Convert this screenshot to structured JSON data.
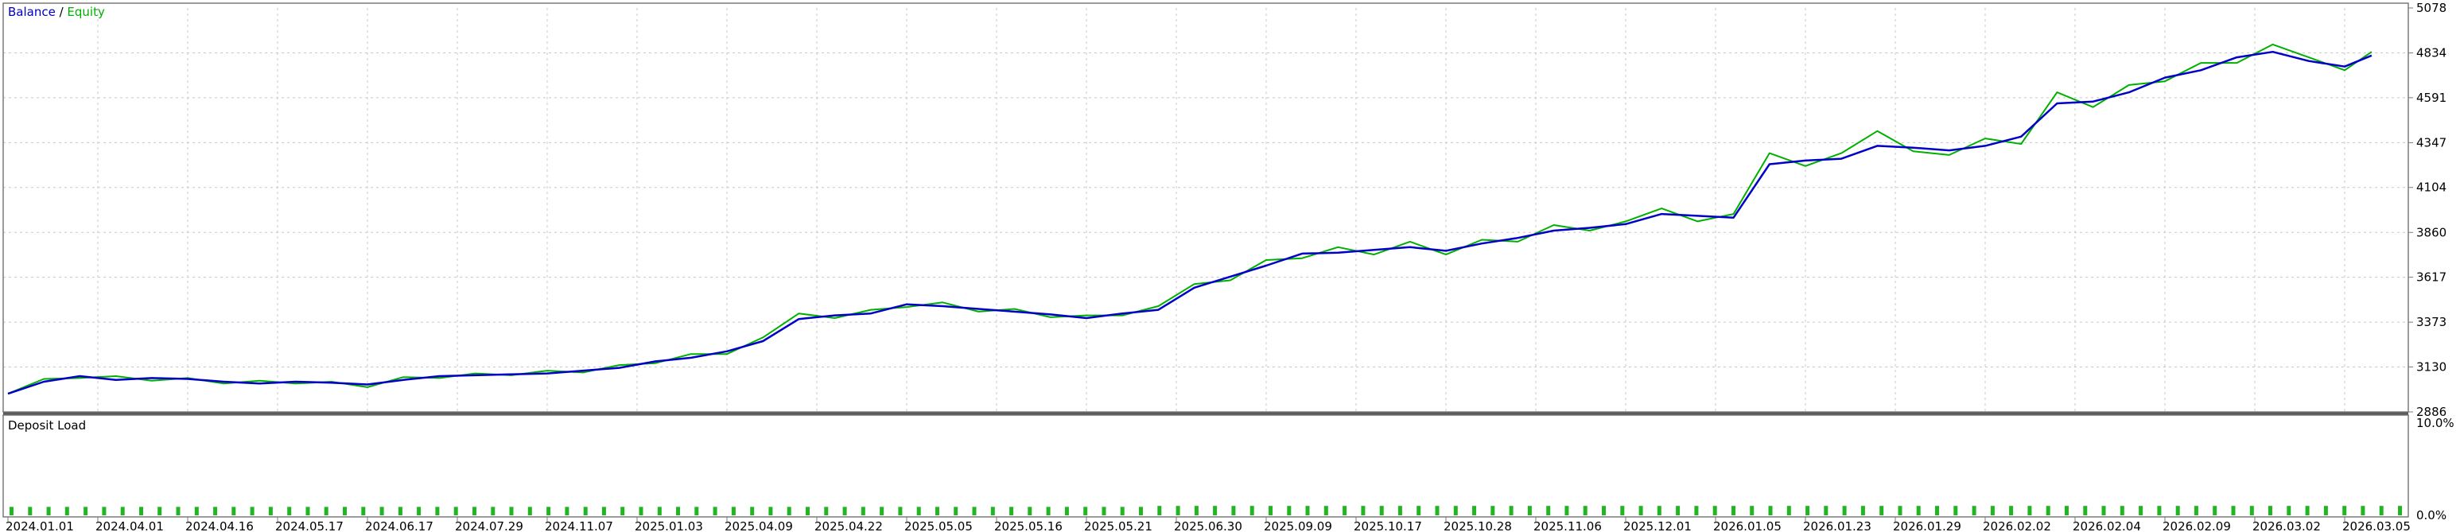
{
  "chart_data": [
    {
      "type": "line",
      "title": "Balance / Equity",
      "legend": [
        {
          "name": "Balance",
          "color": "#0000c8"
        },
        {
          "name": "Equity",
          "color": "#00b000"
        }
      ],
      "title_separator": " / ",
      "ylim": [
        2886,
        5078
      ],
      "y_ticks": [
        "5078",
        "4834",
        "4591",
        "4347",
        "4104",
        "3860",
        "3617",
        "3373",
        "3130",
        "2886"
      ],
      "x_ticks": [
        "2024.01.01",
        "2024.04.01",
        "2024.04.16",
        "2024.05.17",
        "2024.06.17",
        "2024.07.29",
        "2024.11.07",
        "2025.01.03",
        "2025.04.09",
        "2025.04.22",
        "2025.05.05",
        "2025.05.16",
        "2025.05.21",
        "2025.06.30",
        "2025.09.09",
        "2025.10.17",
        "2025.10.28",
        "2025.11.06",
        "2025.12.01",
        "2026.01.05",
        "2026.01.23",
        "2026.01.29",
        "2026.02.02",
        "2026.02.04",
        "2026.02.09",
        "2026.03.02",
        "2026.03.05"
      ],
      "grid": true,
      "legend_placement": "top-left",
      "series": [
        {
          "name": "Balance",
          "color": "#0000c8",
          "x_tick_index": [
            0,
            0.4,
            0.8,
            1.2,
            1.6,
            2.0,
            2.4,
            2.8,
            3.2,
            3.6,
            4.0,
            4.4,
            4.8,
            5.2,
            5.6,
            6.0,
            6.4,
            6.8,
            7.2,
            7.6,
            8.0,
            8.4,
            8.8,
            9.2,
            9.6,
            10.0,
            10.4,
            10.8,
            11.2,
            11.6,
            12.0,
            12.4,
            12.8,
            13.2,
            13.6,
            14.0,
            14.4,
            14.8,
            15.2,
            15.6,
            16.0,
            16.4,
            16.8,
            17.2,
            17.6,
            18.0,
            18.4,
            18.8,
            19.2,
            19.6,
            20.0,
            20.4,
            20.8,
            21.2,
            21.6,
            22.0,
            22.4,
            22.8,
            23.2,
            23.6,
            24.0,
            24.4,
            24.8,
            25.2,
            25.6,
            26.0,
            26.3
          ],
          "values": [
            2985,
            3050,
            3080,
            3060,
            3070,
            3065,
            3050,
            3040,
            3050,
            3045,
            3035,
            3060,
            3080,
            3085,
            3090,
            3095,
            3110,
            3125,
            3160,
            3180,
            3215,
            3270,
            3390,
            3410,
            3420,
            3470,
            3460,
            3445,
            3430,
            3415,
            3395,
            3420,
            3440,
            3560,
            3620,
            3680,
            3745,
            3750,
            3765,
            3780,
            3760,
            3800,
            3830,
            3870,
            3885,
            3905,
            3960,
            3950,
            3940,
            4230,
            4250,
            4260,
            4330,
            4320,
            4305,
            4330,
            4380,
            4560,
            4570,
            4620,
            4700,
            4740,
            4810,
            4840,
            4790,
            4760,
            4820
          ]
        },
        {
          "name": "Equity",
          "color": "#00b000",
          "x_tick_index": [
            0,
            0.4,
            0.8,
            1.2,
            1.6,
            2.0,
            2.4,
            2.8,
            3.2,
            3.6,
            4.0,
            4.4,
            4.8,
            5.2,
            5.6,
            6.0,
            6.4,
            6.8,
            7.2,
            7.6,
            8.0,
            8.4,
            8.8,
            9.2,
            9.6,
            10.0,
            10.4,
            10.8,
            11.2,
            11.6,
            12.0,
            12.4,
            12.8,
            13.2,
            13.6,
            14.0,
            14.4,
            14.8,
            15.2,
            15.6,
            16.0,
            16.4,
            16.8,
            17.2,
            17.6,
            18.0,
            18.4,
            18.8,
            19.2,
            19.6,
            20.0,
            20.4,
            20.8,
            21.2,
            21.6,
            22.0,
            22.4,
            22.8,
            23.2,
            23.6,
            24.0,
            24.4,
            24.8,
            25.2,
            25.6,
            26.0,
            26.3
          ],
          "values": [
            2985,
            3065,
            3070,
            3080,
            3055,
            3070,
            3040,
            3055,
            3040,
            3050,
            3020,
            3075,
            3070,
            3095,
            3085,
            3110,
            3100,
            3140,
            3150,
            3200,
            3200,
            3290,
            3420,
            3395,
            3440,
            3455,
            3480,
            3430,
            3445,
            3400,
            3410,
            3410,
            3460,
            3580,
            3600,
            3710,
            3720,
            3780,
            3740,
            3810,
            3740,
            3820,
            3810,
            3900,
            3870,
            3920,
            3990,
            3920,
            3960,
            4290,
            4220,
            4290,
            4410,
            4300,
            4280,
            4370,
            4340,
            4620,
            4540,
            4660,
            4680,
            4780,
            4780,
            4880,
            4810,
            4740,
            4840
          ]
        }
      ]
    },
    {
      "type": "bar",
      "title": "Deposit Load",
      "ylim": [
        0,
        10
      ],
      "y_ticks": [
        "10.0%",
        "0.0%"
      ],
      "color": "#22b422",
      "values": [
        0.9,
        0.9,
        0.9,
        0.9,
        0.9,
        0.9,
        0.9,
        0.9,
        0.9,
        0.9,
        0.9,
        0.9,
        0.9,
        0.9,
        0.9,
        0.9,
        0.9,
        0.9,
        0.9,
        0.9,
        0.9,
        0.9,
        0.9,
        0.9,
        0.9,
        0.9,
        0.9,
        0.9,
        0.9,
        0.9,
        0.9,
        0.9,
        0.9,
        0.9,
        0.9,
        0.9,
        0.9,
        0.9,
        0.9,
        0.9,
        0.9,
        0.9,
        0.9,
        0.9,
        0.9,
        0.9,
        0.9,
        0.9,
        0.9,
        0.9,
        0.9,
        0.9,
        0.9,
        0.9,
        0.9,
        0.9,
        0.9,
        0.9,
        0.9,
        0.9,
        0.9,
        0.9,
        1.0,
        1.0,
        1.0,
        1.0,
        1.0,
        1.0,
        1.0,
        1.0,
        1.0,
        1.0,
        1.0,
        1.0,
        1.0,
        1.0,
        1.0,
        1.0,
        1.0,
        1.0,
        1.0,
        1.0,
        1.0,
        1.0,
        1.0,
        1.0,
        1.0,
        1.0,
        1.0,
        1.0,
        1.0,
        1.0,
        1.0,
        1.0,
        1.0,
        1.0,
        1.0,
        1.0,
        1.0,
        1.0,
        1.0,
        1.0,
        1.0,
        1.0,
        1.0,
        1.0,
        1.0,
        1.0,
        1.0,
        1.0,
        1.0,
        1.0,
        1.0,
        1.0,
        1.0,
        1.0,
        1.0,
        1.0,
        1.0,
        1.0,
        1.0,
        1.0,
        1.0,
        1.0,
        1.0,
        1.0,
        1.0,
        1.0,
        1.0,
        1.0
      ]
    }
  ]
}
